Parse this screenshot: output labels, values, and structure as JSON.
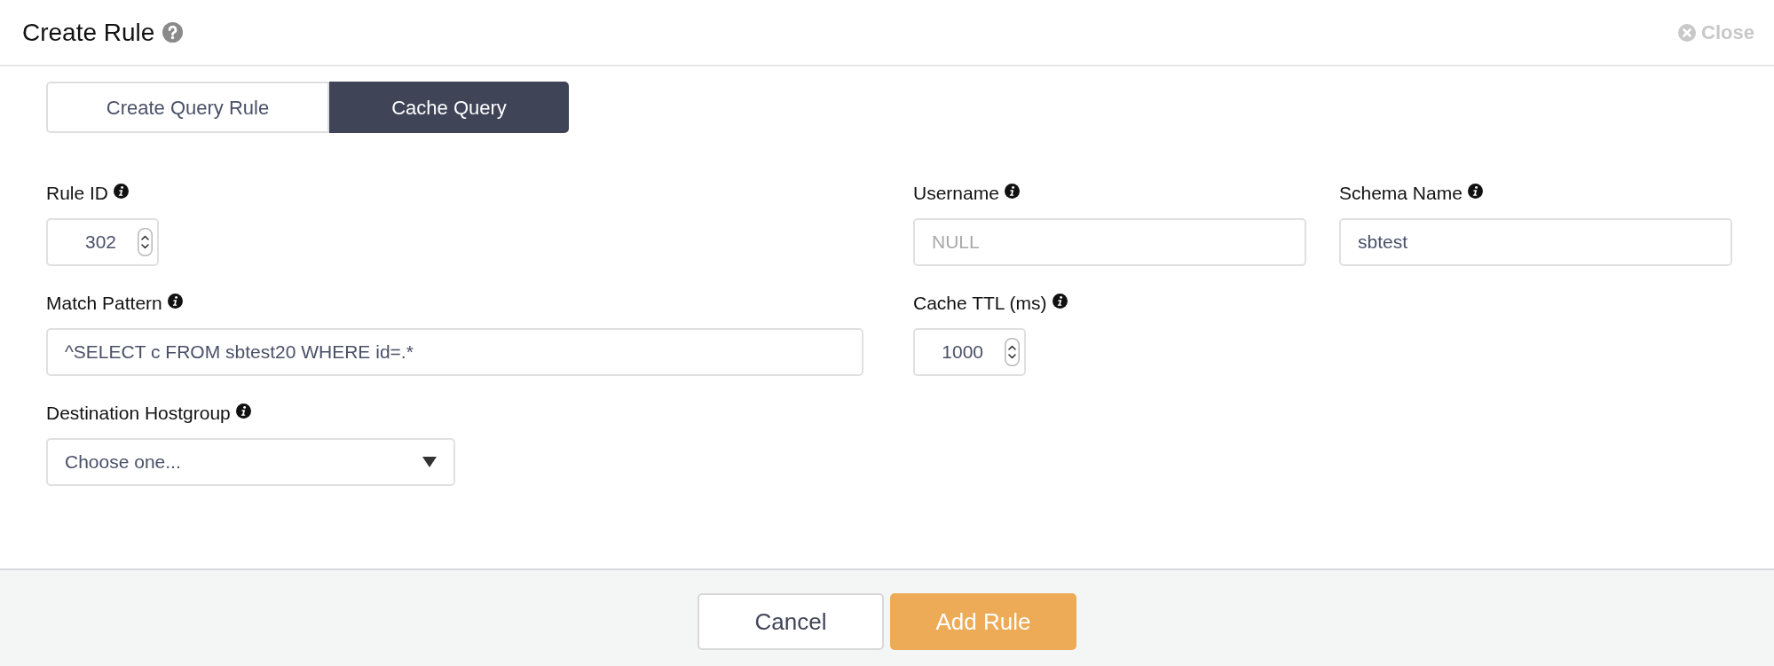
{
  "dialog": {
    "title": "Create Rule",
    "close_label": "Close"
  },
  "tabs": [
    {
      "label": "Create Query Rule",
      "selected": false
    },
    {
      "label": "Cache Query",
      "selected": true
    }
  ],
  "form_rows": [
    {
      "fields": [
        {
          "label": "Rule ID",
          "kind": "number",
          "value": "302"
        },
        {
          "label": "Username",
          "kind": "text",
          "placeholder": "NULL"
        },
        {
          "label": "Schema Name",
          "kind": "text",
          "value": "sbtest"
        }
      ]
    },
    {
      "fields": [
        {
          "label": "Match Pattern",
          "kind": "text",
          "value": "^SELECT c FROM sbtest20 WHERE id=.*"
        },
        {
          "label": "Cache TTL (ms)",
          "kind": "number",
          "value": "1000"
        }
      ]
    },
    {
      "fields": [
        {
          "label": "Destination Hostgroup",
          "kind": "select",
          "value": "Choose one..."
        }
      ]
    }
  ],
  "buttons": [
    {
      "label": "Cancel",
      "kind": "secondary"
    },
    {
      "label": "Add Rule",
      "kind": "primary"
    }
  ]
}
